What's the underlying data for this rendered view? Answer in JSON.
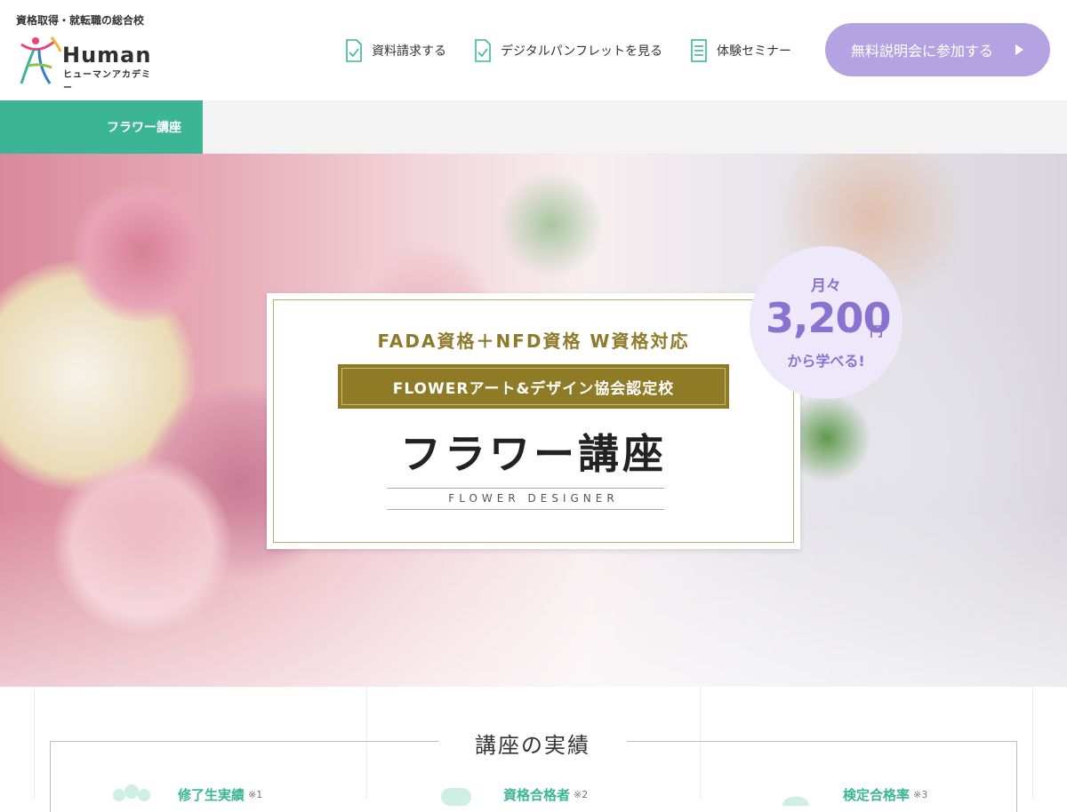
{
  "header": {
    "tagline": "資格取得・就転職の総合校",
    "logo_word": "Human",
    "logo_sub": "ヒューマンアカデミー",
    "nav": [
      {
        "label": "資料請求する",
        "icon": "document-icon"
      },
      {
        "label": "デジタルパンフレットを見る",
        "icon": "pamphlet-icon"
      },
      {
        "label": "体験セミナー",
        "icon": "list-icon"
      }
    ],
    "cta_label": "無料説明会に参加する"
  },
  "subnav": {
    "active_tab": "フラワー講座"
  },
  "hero": {
    "subtitle": "FADA資格＋NFD資格 W資格対応",
    "band": "FLOWERアート&デザイン協会認定校",
    "title": "フラワー講座",
    "title_en": "FLOWER DESIGNER",
    "price": {
      "prefix": "月々",
      "amount": "3,200",
      "unit": "円",
      "suffix": "から学べる!"
    }
  },
  "results": {
    "title": "講座の実績",
    "stats": [
      {
        "label": "修了生実績",
        "note": "※1"
      },
      {
        "label": "資格合格者",
        "note": "※2"
      },
      {
        "label": "検定合格率",
        "note": "※3"
      }
    ]
  },
  "colors": {
    "brand_green": "#3bb594",
    "cta_purple": "#b3a3e3",
    "gold": "#8f7a25",
    "price_text": "#8a73d0"
  }
}
